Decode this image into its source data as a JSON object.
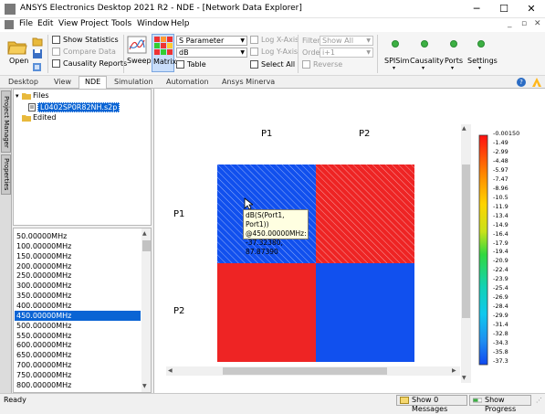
{
  "window": {
    "title": "ANSYS Electronics Desktop 2021 R2 - NDE - [Network Data Explorer]",
    "minimize": "─",
    "maximize": "☐",
    "close": "✕"
  },
  "menu": {
    "items": [
      "File",
      "Edit",
      "View",
      "Project",
      "Tools",
      "Window",
      "Help"
    ],
    "mdi_controls": [
      "_",
      "▫",
      "✕"
    ]
  },
  "ribbon": {
    "open_label": "Open",
    "show_statistics": "Show Statistics",
    "compare_data": "Compare Data",
    "causality_reports": "Causality Reports",
    "sweep_label": "Sweep",
    "matrix_label": "Matrix",
    "param_combo": "S Parameter",
    "format_combo": "dB",
    "third_combo": "",
    "table_label": "Table",
    "log_x": "Log X-Axis",
    "log_y": "Log Y-Axis",
    "select_all": "Select All",
    "filter_label": "Filter",
    "filter_value": "Show All",
    "order_label": "Order",
    "order_value": "i+1",
    "reverse_label": "Reverse",
    "spisim_label": "SPISim",
    "causality_label": "Causality",
    "ports_label": "Ports",
    "settings_label": "Settings"
  },
  "tabs": [
    "Desktop",
    "View",
    "NDE",
    "Simulation",
    "Automation",
    "Ansys Minerva"
  ],
  "active_tab": "NDE",
  "side_tabs": [
    "Project Manager",
    "Properties"
  ],
  "tree": {
    "root": "Files",
    "file": "L0402SP0R82NH.s2p",
    "edited": "Edited"
  },
  "frequencies": {
    "items": [
      "50.00000MHz",
      "100.00000MHz",
      "150.00000MHz",
      "200.00000MHz",
      "250.00000MHz",
      "300.00000MHz",
      "350.00000MHz",
      "400.00000MHz",
      "450.00000MHz",
      "500.00000MHz",
      "550.00000MHz",
      "600.00000MHz",
      "650.00000MHz",
      "700.00000MHz",
      "750.00000MHz",
      "800.00000MHz"
    ],
    "selected_index": 8
  },
  "matrix": {
    "col_labels": [
      "P1",
      "P2"
    ],
    "row_labels": [
      "P1",
      "P2"
    ],
    "tooltip": [
      "dB(S(Port1, Port1))",
      "@450.00000MHz:",
      "-37.32380, 87.87390"
    ],
    "colorbar_ticks": [
      "-0.00150",
      "-1.49",
      "-2.99",
      "-4.48",
      "-5.97",
      "-7.47",
      "-8.96",
      "-10.5",
      "-11.9",
      "-13.4",
      "-14.9",
      "-16.4",
      "-17.9",
      "-19.4",
      "-20.9",
      "-22.4",
      "-23.9",
      "-25.4",
      "-26.9",
      "-28.4",
      "-29.9",
      "-31.4",
      "-32.8",
      "-34.3",
      "-35.8",
      "-37.3"
    ]
  },
  "status": {
    "text": "Ready",
    "messages_btn": "Show 0 Messages",
    "progress_btn": "Show Progress"
  },
  "colors": {
    "high": "#ee2424",
    "low": "#1150ee",
    "selection": "#0a64d4"
  }
}
